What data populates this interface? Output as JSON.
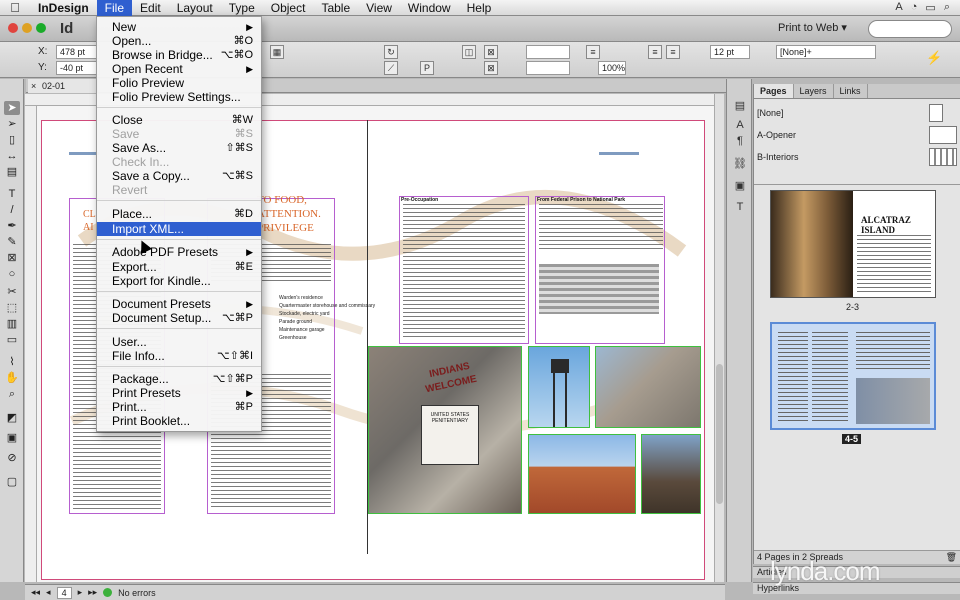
{
  "menubar": {
    "app": "InDesign",
    "items": [
      "File",
      "Edit",
      "Layout",
      "Type",
      "Object",
      "Table",
      "View",
      "Window",
      "Help"
    ],
    "active": "File"
  },
  "appbar": {
    "logo": "Id",
    "workspace": "Print to Web ▾"
  },
  "control": {
    "x_label": "X:",
    "x_value": "478 pt",
    "y_label": "Y:",
    "y_value": "-40 pt",
    "zoom_value": "100%",
    "pt_value": "12 pt",
    "style_value": "[None]+"
  },
  "document": {
    "tab_title": "02-01 Begin.i..."
  },
  "file_menu": [
    {
      "label": "New",
      "shortcut": "",
      "submenu": true,
      "disabled": false
    },
    {
      "label": "Open...",
      "shortcut": "⌘O",
      "submenu": false,
      "disabled": false
    },
    {
      "label": "Browse in Bridge...",
      "shortcut": "⌥⌘O",
      "submenu": false,
      "disabled": false
    },
    {
      "label": "Open Recent",
      "shortcut": "",
      "submenu": true,
      "disabled": false
    },
    {
      "label": "Folio Preview",
      "shortcut": "",
      "submenu": false,
      "disabled": false
    },
    {
      "label": "Folio Preview Settings...",
      "shortcut": "",
      "submenu": false,
      "disabled": false
    },
    {
      "label": "Close",
      "shortcut": "⌘W",
      "submenu": false,
      "disabled": false
    },
    {
      "label": "Save",
      "shortcut": "⌘S",
      "submenu": false,
      "disabled": true
    },
    {
      "label": "Save As...",
      "shortcut": "⇧⌘S",
      "submenu": false,
      "disabled": false
    },
    {
      "label": "Check In...",
      "shortcut": "",
      "submenu": false,
      "disabled": true
    },
    {
      "label": "Save a Copy...",
      "shortcut": "⌥⌘S",
      "submenu": false,
      "disabled": false
    },
    {
      "label": "Revert",
      "shortcut": "",
      "submenu": false,
      "disabled": true
    },
    {
      "label": "Place...",
      "shortcut": "⌘D",
      "submenu": false,
      "disabled": false
    },
    {
      "label": "Import XML...",
      "shortcut": "",
      "submenu": false,
      "disabled": false,
      "highlighted": true
    },
    {
      "label": "Adobe PDF Presets",
      "shortcut": "",
      "submenu": true,
      "disabled": false
    },
    {
      "label": "Export...",
      "shortcut": "⌘E",
      "submenu": false,
      "disabled": false
    },
    {
      "label": "Export for Kindle...",
      "shortcut": "",
      "submenu": false,
      "disabled": false
    },
    {
      "label": "Document Presets",
      "shortcut": "",
      "submenu": true,
      "disabled": false
    },
    {
      "label": "Document Setup...",
      "shortcut": "⌥⌘P",
      "submenu": false,
      "disabled": false
    },
    {
      "label": "User...",
      "shortcut": "",
      "submenu": false,
      "disabled": false
    },
    {
      "label": "File Info...",
      "shortcut": "⌥⇧⌘I",
      "submenu": false,
      "disabled": false
    },
    {
      "label": "Package...",
      "shortcut": "⌥⇧⌘P",
      "submenu": false,
      "disabled": false
    },
    {
      "label": "Print Presets",
      "shortcut": "",
      "submenu": true,
      "disabled": false
    },
    {
      "label": "Print...",
      "shortcut": "⌘P",
      "submenu": false,
      "disabled": false
    },
    {
      "label": "Print Booklet...",
      "shortcut": "",
      "submenu": false,
      "disabled": false
    }
  ],
  "spread": {
    "headline_right": "TO FOOD,",
    "headline_right2": "ATTENTION.",
    "headline_right3": "PRIVILEGE",
    "headline_left": "CL",
    "headline_left2": "AI",
    "caption_left": "Pre-Occupation",
    "caption_right": "From Federal Prison to National Park",
    "sign_line1": "INDIANS",
    "sign_line2": "WELCOME",
    "sign_line3": "UNITED STATES",
    "sign_line4": "PENITENTIARY",
    "list_items": [
      "Warden's residence",
      "Quartermaster storehouse and commissary",
      "Stockade, electric yard",
      "Parade ground",
      "Maintenance garage",
      "Greenhouse"
    ]
  },
  "panels": {
    "tabs": [
      "Pages",
      "Layers",
      "Links"
    ],
    "masters": [
      "[None]",
      "A-Opener",
      "B-Interiors"
    ],
    "thumb_title": "ALCATRAZ ISLAND",
    "spread_labels": [
      "2-3",
      "4-5"
    ],
    "footer": "4 Pages in 2 Spreads",
    "collapsed": [
      "Articles",
      "Hyperlinks"
    ]
  },
  "status": {
    "page": "4",
    "errors": "No errors"
  },
  "watermark": "lynda.com"
}
